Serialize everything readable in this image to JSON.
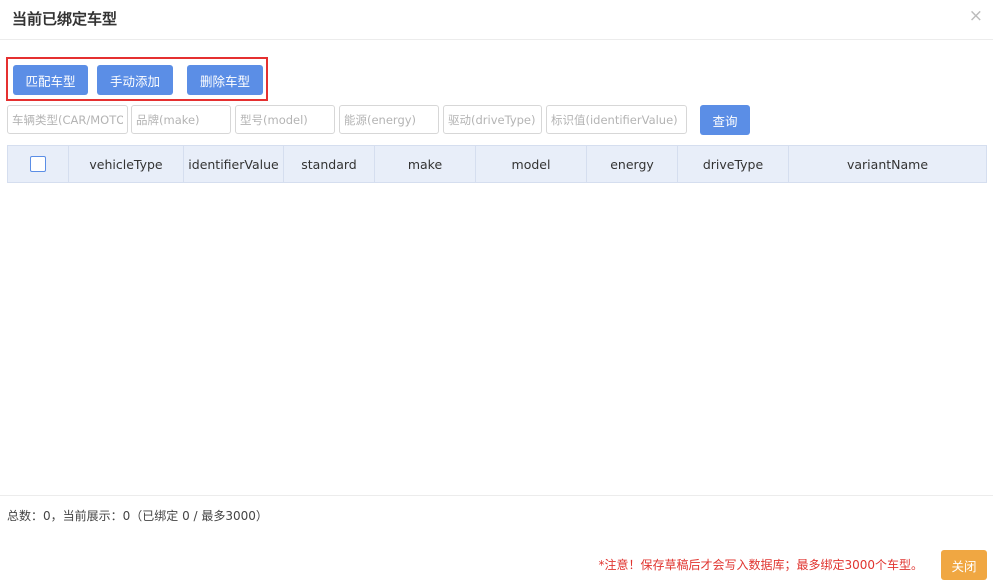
{
  "dialog": {
    "title": "当前已绑定车型",
    "close_symbol": "×"
  },
  "toolbar": {
    "match_label": "匹配车型",
    "manual_add_label": "手动添加",
    "delete_label": "删除车型"
  },
  "filters": {
    "vehicle_type_placeholder": "车辆类型(CAR/MOTO)",
    "make_placeholder": "品牌(make)",
    "model_placeholder": "型号(model)",
    "energy_placeholder": "能源(energy)",
    "drive_type_placeholder": "驱动(driveType)",
    "identifier_placeholder": "标识值(identifierValue)",
    "query_label": "查询"
  },
  "table": {
    "columns": [
      "vehicleType",
      "identifierValue",
      "standard",
      "make",
      "model",
      "energy",
      "driveType",
      "variantName"
    ],
    "rows": []
  },
  "footer": {
    "summary": "总数：0，当前展示：0（已绑定 0 / 最多3000）",
    "notice": "*注意！保存草稿后才会写入数据库；最多绑定3000个车型。",
    "close_label": "关闭"
  },
  "colors": {
    "primary": "#5b8ee6",
    "warning_button": "#f0a742",
    "highlight_border": "#e53030",
    "notice_text": "#e0342f",
    "table_header_bg": "#e8eef9"
  }
}
